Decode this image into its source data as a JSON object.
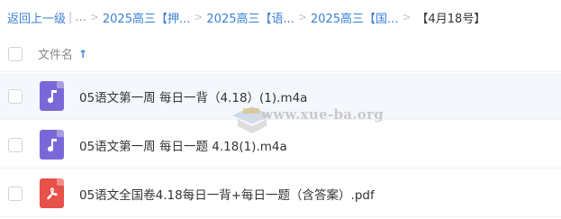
{
  "breadcrumb": {
    "back": "返回上一级",
    "ellipsis": "...",
    "items": [
      "2025高三【押...",
      "2025高三【语...",
      "2025高三【国..."
    ],
    "current": "【4月18号】"
  },
  "header": {
    "name_label": "文件名",
    "sort": "ascending"
  },
  "files": [
    {
      "name": "05语文第一周 每日一背（4.18）(1).m4a",
      "type": "audio",
      "icon": "music-note-icon"
    },
    {
      "name": "05语文第一周 每日一题 4.18(1).m4a",
      "type": "audio",
      "icon": "music-note-icon"
    },
    {
      "name": "05语文全国卷4.18每日一背+每日一题（含答案）.pdf",
      "type": "pdf",
      "icon": "pdf-icon"
    }
  ],
  "watermark": {
    "text": "www.xue-ba.org"
  },
  "colors": {
    "link": "#3a7fd5",
    "audio_icon": "#7b68d8",
    "pdf_icon": "#e8504a",
    "row_hover": "#f4f8fd"
  }
}
